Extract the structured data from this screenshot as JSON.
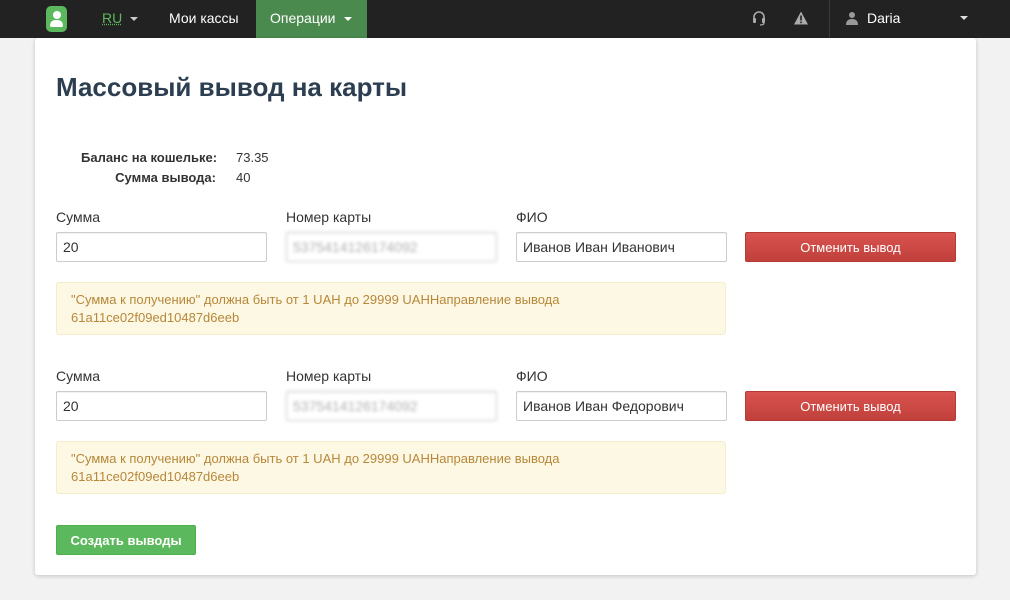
{
  "navbar": {
    "lang": "RU",
    "menu_cashboxes": "Мои кассы",
    "menu_operations": "Операции",
    "user_name": "Daria",
    "icons": [
      "logo-icon",
      "headset-icon",
      "warning-icon",
      "user-icon"
    ]
  },
  "page": {
    "title": "Массовый вывод на карты"
  },
  "summary": {
    "balance_label": "Баланс на кошельке:",
    "balance_value": "73.35",
    "withdraw_label": "Сумма вывода:",
    "withdraw_value": "40"
  },
  "withdrawals": [
    {
      "amount_label": "Сумма",
      "amount_value": "20",
      "card_label": "Номер карты",
      "card_value": "5375414126174092",
      "name_label": "ФИО",
      "name_value": "Иванов Иван Иванович",
      "cancel_label": "Отменить вывод",
      "alert_line1": "\"Сумма к получению\" должна быть от 1 UAH до 29999 UAHНаправление вывода",
      "alert_line2": "61a11ce02f09ed10487d6eeb"
    },
    {
      "amount_label": "Сумма",
      "amount_value": "20",
      "card_label": "Номер карты",
      "card_value": "5375414126174092",
      "name_label": "ФИО",
      "name_value": "Иванов Иван Федорович",
      "cancel_label": "Отменить вывод",
      "alert_line1": "\"Сумма к получению\" должна быть от 1 UAH до 29999 UAHНаправление вывода",
      "alert_line2": "61a11ce02f09ed10487d6eeb"
    }
  ],
  "actions": {
    "create_label": "Создать выводы"
  },
  "colors": {
    "navbar_bg": "#222222",
    "accent_green": "#5cb85c",
    "danger_red": "#d9534f",
    "alert_bg": "#fcf8e3",
    "alert_text": "#b8873a",
    "title_color": "#2c3e50"
  }
}
